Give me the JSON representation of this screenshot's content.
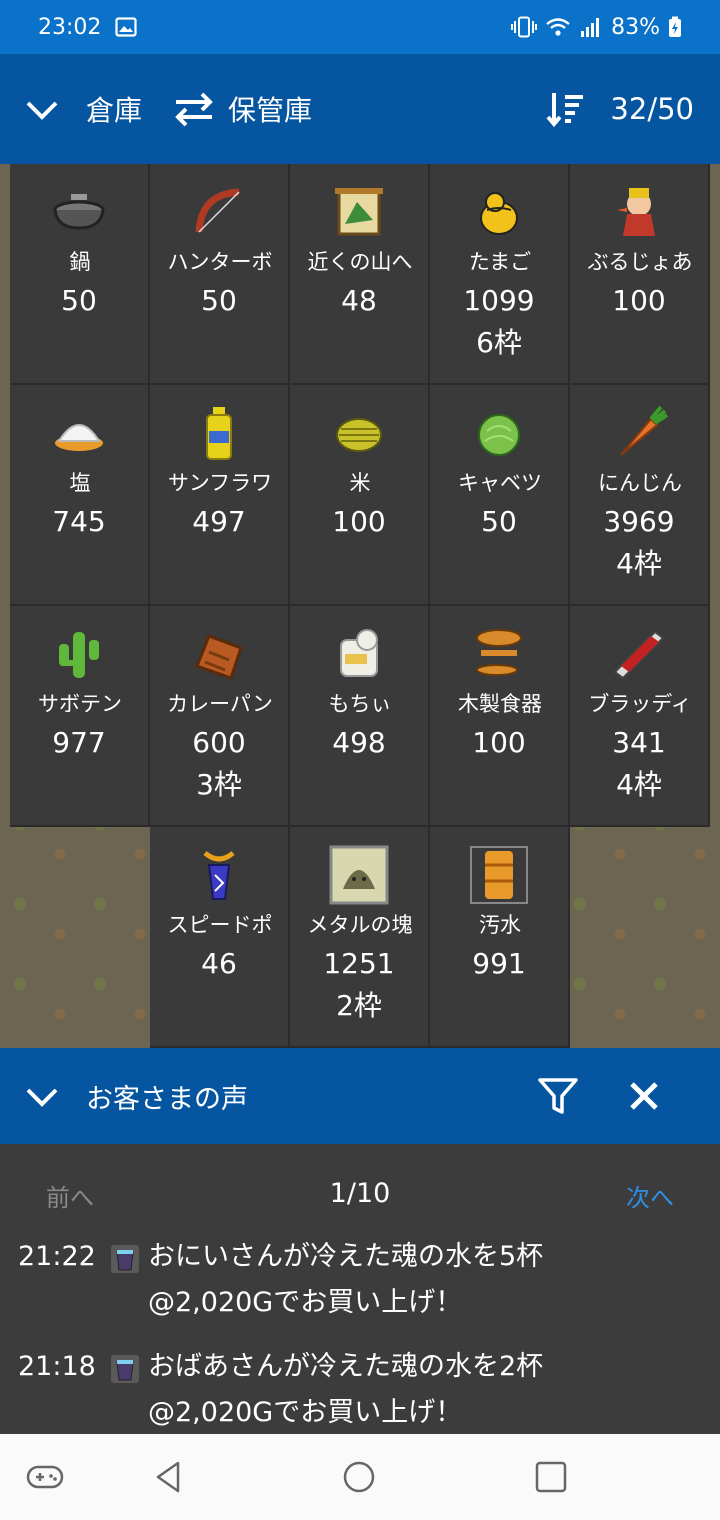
{
  "status_bar": {
    "time": "23:02",
    "battery": "83%"
  },
  "warehouse": {
    "title": "倉庫",
    "storage_label": "保管庫",
    "count": "32/50",
    "items": [
      {
        "name": "鍋",
        "qty": "50",
        "slots": "",
        "icon": "pot-icon",
        "color": "#8c8c8c"
      },
      {
        "name": "ハンターボ",
        "qty": "50",
        "slots": "",
        "icon": "bow-icon",
        "color": "#b03a24"
      },
      {
        "name": "近くの山へ",
        "qty": "48",
        "slots": "",
        "icon": "map-icon",
        "color": "#3d8c3a"
      },
      {
        "name": "たまご",
        "qty": "1099",
        "slots": "6枠",
        "icon": "egg-chick-icon",
        "color": "#f2c11a"
      },
      {
        "name": "ぶるじょあ",
        "qty": "100",
        "slots": "",
        "icon": "bourgeois-icon",
        "color": "#c0392b"
      },
      {
        "name": "塩",
        "qty": "745",
        "slots": "",
        "icon": "salt-icon",
        "color": "#f4f4f4"
      },
      {
        "name": "サンフラワ",
        "qty": "497",
        "slots": "",
        "icon": "oil-bottle-icon",
        "color": "#e6d21a"
      },
      {
        "name": "米",
        "qty": "100",
        "slots": "",
        "icon": "rice-icon",
        "color": "#c9c22a"
      },
      {
        "name": "キャベツ",
        "qty": "50",
        "slots": "",
        "icon": "cabbage-icon",
        "color": "#7cc24a"
      },
      {
        "name": "にんじん",
        "qty": "3969",
        "slots": "4枠",
        "icon": "carrot-icon",
        "color": "#e8722a"
      },
      {
        "name": "サボテン",
        "qty": "977",
        "slots": "",
        "icon": "cactus-icon",
        "color": "#5fb83c"
      },
      {
        "name": "カレーパン",
        "qty": "600",
        "slots": "3枠",
        "icon": "curry-bread-icon",
        "color": "#b85a22"
      },
      {
        "name": "もちぃ",
        "qty": "498",
        "slots": "",
        "icon": "mochi-icon",
        "color": "#f0efe6"
      },
      {
        "name": "木製食器",
        "qty": "100",
        "slots": "",
        "icon": "wooden-dish-icon",
        "color": "#d98a2a"
      },
      {
        "name": "ブラッディ",
        "qty": "341",
        "slots": "4枠",
        "icon": "bloody-blade-icon",
        "color": "#c42222"
      },
      {
        "name": "スピードポ",
        "qty": "46",
        "slots": "",
        "icon": "speed-potion-icon",
        "color": "#3a3ac4"
      },
      {
        "name": "メタルの塊",
        "qty": "1251",
        "slots": "2枠",
        "icon": "metal-slime-icon",
        "color": "#6b6b4a"
      },
      {
        "name": "汚水",
        "qty": "991",
        "slots": "",
        "icon": "dirty-water-icon",
        "color": "#e89a2a"
      }
    ]
  },
  "reviews": {
    "title": "お客さまの声",
    "prev_label": "前へ",
    "page": "1/10",
    "next_label": "次へ",
    "messages": [
      {
        "time": "21:22",
        "line1": "おにいさんが冷えた魂の水を5杯",
        "line2": "@2,020Gでお買い上げ！"
      },
      {
        "time": "21:18",
        "line1": "おばあさんが冷えた魂の水を2杯",
        "line2": "@2,020Gでお買い上げ！"
      }
    ]
  },
  "colors": {
    "header_blue": "#0555a0",
    "status_blue": "#0b72c9",
    "link_blue": "#2f8fe5"
  }
}
